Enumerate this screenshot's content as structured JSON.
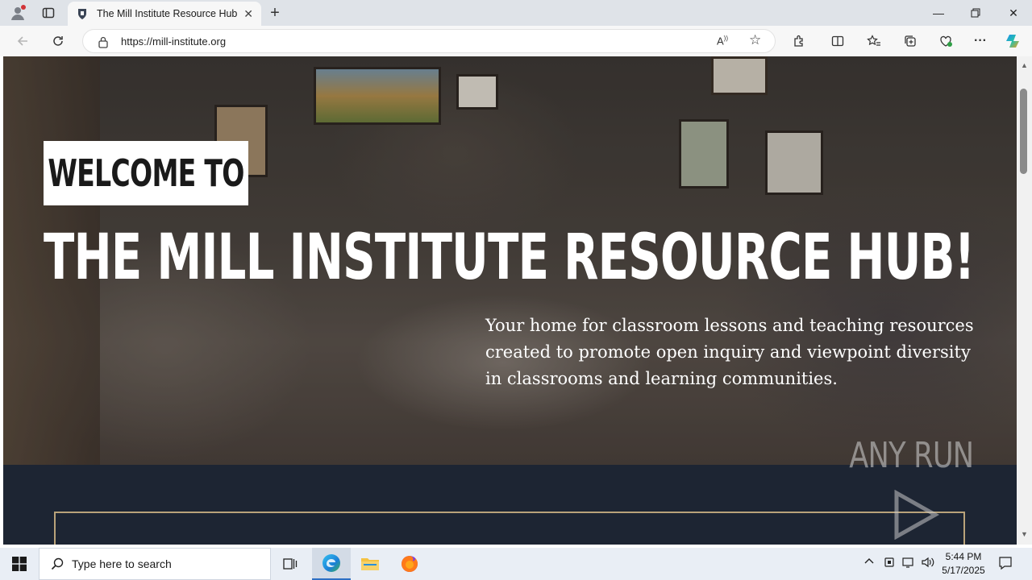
{
  "browser": {
    "tab_title": "The Mill Institute Resource Hub",
    "url": "https://mill-institute.org"
  },
  "hero": {
    "welcome": "WELCOME TO",
    "headline": "THE MILL INSTITUTE RESOURCE HUB!",
    "subtext": "Your home for classroom lessons and teaching resources created to promote open inquiry and viewpoint diversity in classrooms and learning communities."
  },
  "watermark": "ANY RUN",
  "taskbar": {
    "search_placeholder": "Type here to search",
    "time": "5:44 PM",
    "date": "5/17/2025"
  },
  "colors": {
    "hero_lower": "#1d2533",
    "gold_border": "#b9a37a",
    "edge_accent": "#2d6fc4"
  }
}
